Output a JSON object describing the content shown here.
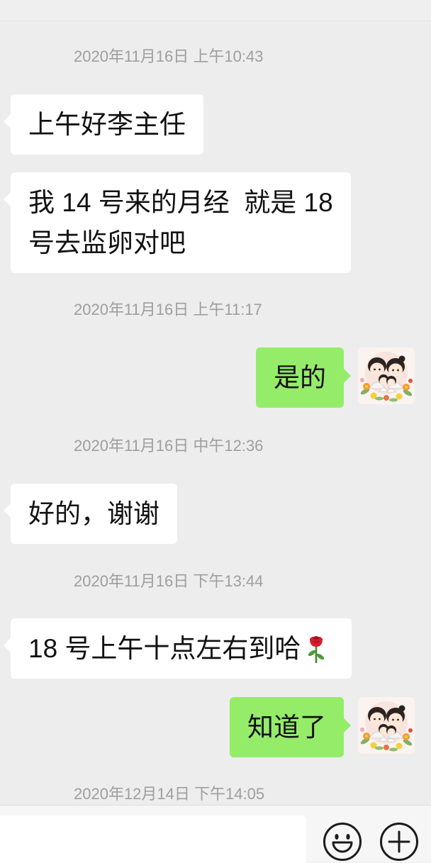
{
  "colors": {
    "chat_background": "#ededed",
    "incoming_bubble": "#ffffff",
    "outgoing_bubble": "#95ec69",
    "timestamp_text": "#9e9e9e",
    "message_text": "#111111",
    "input_bar": "#f6f6f6"
  },
  "chat": {
    "timestamps": [
      "2020年11月16日 上午10:43",
      "2020年11月16日 上午11:17",
      "2020年11月16日 中午12:36",
      "2020年11月16日 下午13:44",
      "2020年12月14日 下午14:05"
    ],
    "messages": [
      {
        "text": "上午好李主任",
        "outgoing": false
      },
      {
        "lines": [
          "我 14 号来的月经  就是 18",
          "号去监卵对吧"
        ],
        "outgoing": false
      },
      {
        "text": "是的",
        "outgoing": true,
        "avatar_icon": "cartoon-family-avatar"
      },
      {
        "text": "好的，谢谢",
        "outgoing": false
      },
      {
        "text": "18 号上午十点左右到哈",
        "outgoing": false,
        "emoji_icon": "rose-icon"
      },
      {
        "text": "知道了",
        "outgoing": true,
        "avatar_icon": "cartoon-family-avatar"
      }
    ]
  },
  "input_bar": {
    "input_value": "",
    "emoji_button_icon": "smiley-face-icon",
    "more_button_icon": "plus-circle-icon"
  }
}
